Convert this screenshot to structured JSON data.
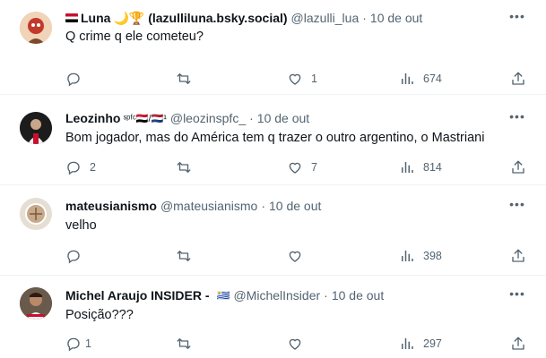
{
  "tweets": [
    {
      "name": "Luna",
      "name_suffix": "🌙🏆 (lazulliluna.bsky.social)",
      "handle": "@lazulli_lua",
      "time": "10 de out",
      "text": "Q crime q ele cometeu?",
      "replies": "",
      "retweets": "",
      "likes": "1",
      "views": "674"
    },
    {
      "name": "Leozinho",
      "name_suffix": "ˢᵖᶠᶜ🇾🇪/🇳🇱¹",
      "handle": "@leozinspfc_",
      "time": "10 de out",
      "text": "Bom jogador, mas do América tem q trazer o outro argentino, o Mastriani",
      "replies": "2",
      "retweets": "",
      "likes": "7",
      "views": "814"
    },
    {
      "name": "mateusianismo",
      "name_suffix": "",
      "handle": "@mateusianismo",
      "time": "10 de out",
      "text": "velho",
      "replies": "",
      "retweets": "",
      "likes": "",
      "views": "398"
    },
    {
      "name": "Michel Araujo INSIDER -",
      "name_suffix": "🇺🇾",
      "handle": "@MichelInsider",
      "time": "10 de out",
      "text": "Posição???",
      "replies": "1",
      "retweets": "",
      "likes": "",
      "views": "297"
    }
  ],
  "colors": {
    "text": "#0f1419",
    "secondary": "#536471",
    "divider": "#eff3f4"
  }
}
